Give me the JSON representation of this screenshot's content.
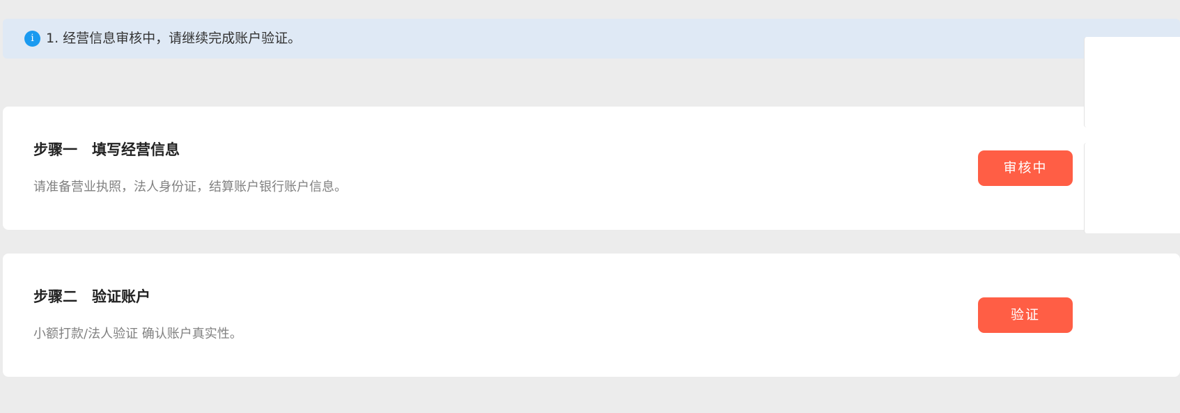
{
  "notice": {
    "icon": "info-icon",
    "icon_glyph": "i",
    "text": "1. 经营信息审核中，请继续完成账户验证。",
    "icon_color": "#1a9af0",
    "background": "#dfe9f5"
  },
  "steps": [
    {
      "title": "步骤一　填写经营信息",
      "description": "请准备营业执照，法人身份证，结算账户银行账户信息。",
      "button_label": "审核中"
    },
    {
      "title": "步骤二　验证账户",
      "description": "小额打款/法人验证 确认账户真实性。",
      "button_label": "验证"
    }
  ],
  "colors": {
    "accent": "#ff5e45",
    "page_background": "#ececec",
    "card_background": "#ffffff"
  }
}
